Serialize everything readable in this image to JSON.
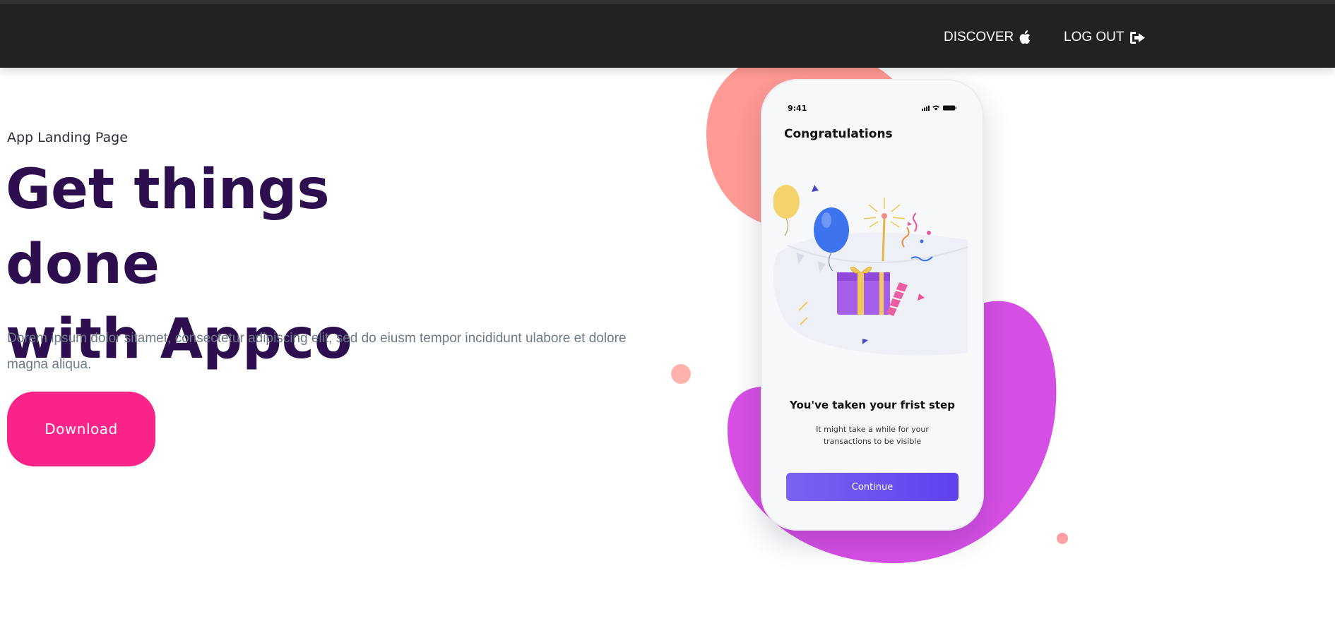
{
  "nav": {
    "discover_label": "DISCOVER",
    "discover_icon": "apple-icon",
    "logout_label": "LOG OUT",
    "logout_icon": "sign-out-icon"
  },
  "hero": {
    "eyebrow": "App Landing Page",
    "headline_line1": "Get things done",
    "headline_line2": "with Appco",
    "lead": "Dorem ipsum dolor sitamet, consectetur adipiscing elit, sed do eiusm tempor incididunt ulabore et dolore magna aliqua.",
    "download_label": "Download"
  },
  "phone": {
    "time": "9:41",
    "title": "Congratulations",
    "step_title": "You've taken your frist step",
    "step_desc": "It might take a while for your transactions to be visible",
    "continue_label": "Continue"
  },
  "colors": {
    "accent_pink": "#fa2388",
    "headline": "#2d0f4f",
    "topbar": "#222222",
    "blob_coral": "#ff9a94",
    "blob_magenta": "#d64fe4",
    "continue_button": "#6a4ff0"
  }
}
